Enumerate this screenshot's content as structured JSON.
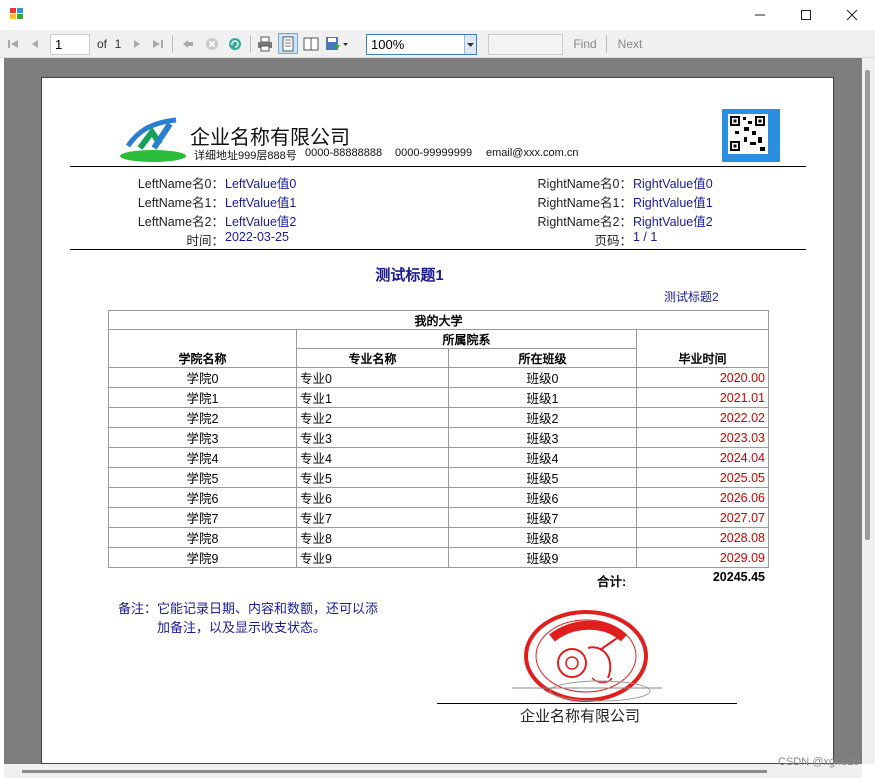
{
  "toolbar": {
    "page_input": "1",
    "page_of": "of",
    "page_total": "1",
    "zoom": "100%",
    "find_input": "",
    "find_label": "Find",
    "next_label": "Next"
  },
  "report": {
    "company_name": "企业名称有限公司",
    "company_address": "详细地址999层888号",
    "phone1": "0000-88888888",
    "phone2": "0000-99999999",
    "email": "email@xxx.com.cn",
    "left_fields": [
      {
        "name": "LeftName名0：",
        "value": "LeftValue值0"
      },
      {
        "name": "LeftName名1：",
        "value": "LeftValue值1"
      },
      {
        "name": "LeftName名2：",
        "value": "LeftValue值2"
      },
      {
        "name": "时间：",
        "value": "2022-03-25"
      }
    ],
    "right_fields": [
      {
        "name": "RightName名0：",
        "value": "RightValue值0"
      },
      {
        "name": "RightName名1：",
        "value": "RightValue值1"
      },
      {
        "name": "RightName名2：",
        "value": "RightValue值2"
      },
      {
        "name": "页码：",
        "value": "1 / 1"
      }
    ],
    "title1": "测试标题1",
    "title2": "测试标题2",
    "table": {
      "group_header": "我的大学",
      "subgroup_header": "所属院系",
      "col_college": "学院名称",
      "col_major": "专业名称",
      "col_class": "所在班级",
      "col_grad": "毕业时间",
      "rows": [
        {
          "college": "学院0",
          "major": "专业0",
          "class": "班级0",
          "grad": "2020.00"
        },
        {
          "college": "学院1",
          "major": "专业1",
          "class": "班级1",
          "grad": "2021.01"
        },
        {
          "college": "学院2",
          "major": "专业2",
          "class": "班级2",
          "grad": "2022.02"
        },
        {
          "college": "学院3",
          "major": "专业3",
          "class": "班级3",
          "grad": "2023.03"
        },
        {
          "college": "学院4",
          "major": "专业4",
          "class": "班级4",
          "grad": "2024.04"
        },
        {
          "college": "学院5",
          "major": "专业5",
          "class": "班级5",
          "grad": "2025.05"
        },
        {
          "college": "学院6",
          "major": "专业6",
          "class": "班级6",
          "grad": "2026.06"
        },
        {
          "college": "学院7",
          "major": "专业7",
          "class": "班级7",
          "grad": "2027.07"
        },
        {
          "college": "学院8",
          "major": "专业8",
          "class": "班级8",
          "grad": "2028.08"
        },
        {
          "college": "学院9",
          "major": "专业9",
          "class": "班级9",
          "grad": "2029.09"
        }
      ]
    },
    "total_label": "合计:",
    "total_value": "20245.45",
    "note_line1": "备注：它能记录日期、内容和数额，还可以添",
    "note_line2": "加备注，以及显示收支状态。",
    "seal_company": "企业名称有限公司"
  },
  "watermark": "CSDN @xgh815",
  "colors": {
    "link_blue": "#1a1a9c",
    "value_red": "#d00000",
    "viewer_gray": "#7d7d7d"
  },
  "icons": [
    "app-icon",
    "minimize-icon",
    "maximize-icon",
    "close-icon",
    "first-page-icon",
    "prev-page-icon",
    "next-page-icon",
    "last-page-icon",
    "back-icon",
    "stop-icon",
    "refresh-icon",
    "print-icon",
    "print-layout-icon",
    "page-setup-icon",
    "export-icon",
    "dropdown-arrow-icon",
    "logo-icon",
    "qr-code-icon",
    "seal-icon"
  ]
}
